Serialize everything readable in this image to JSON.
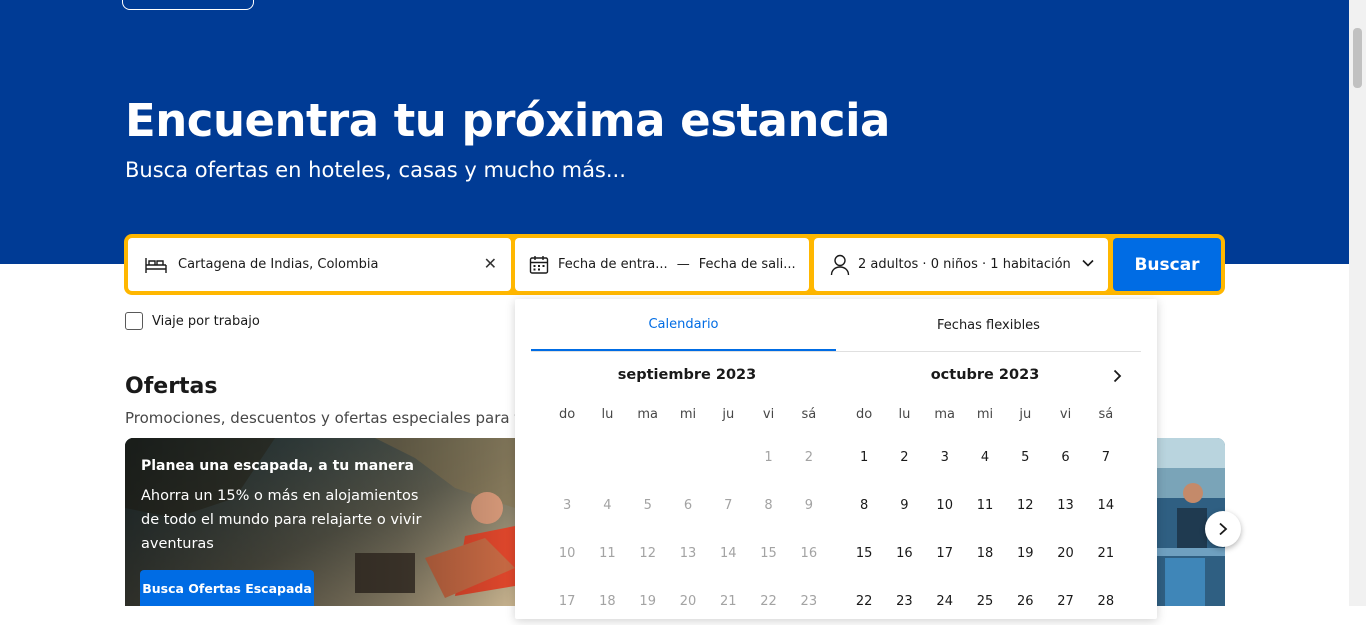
{
  "hero": {
    "title": "Encuentra tu próxima estancia",
    "subtitle": "Busca ofertas en hoteles, casas y mucho más..."
  },
  "search": {
    "destination": "Cartagena de Indias, Colombia",
    "checkin": "Fecha de entra...",
    "separator": "—",
    "checkout": "Fecha de sali...",
    "guests": "2 adultos · 0 niños · 1 habitación",
    "button": "Buscar"
  },
  "work_trip": {
    "label": "Viaje por trabajo",
    "checked": false
  },
  "offers": {
    "title": "Ofertas",
    "subtitle": "Promociones, descuentos y ofertas especiales para ti",
    "card": {
      "title": "Planea una escapada, a tu manera",
      "text": "Ahorra un 15% o más en alojamientos de todo el mundo para relajarte o vivir aventuras",
      "button": "Busca Ofertas Escapada"
    }
  },
  "calendar": {
    "tabs": [
      "Calendario",
      "Fechas flexibles"
    ],
    "active_tab": "Calendario",
    "weekdays": [
      "do",
      "lu",
      "ma",
      "mi",
      "ju",
      "vi",
      "sá"
    ],
    "months": [
      {
        "title": "septiembre 2023",
        "weeks": [
          [
            "",
            "",
            "",
            "",
            "",
            "1",
            "2"
          ],
          [
            "3",
            "4",
            "5",
            "6",
            "7",
            "8",
            "9"
          ],
          [
            "10",
            "11",
            "12",
            "13",
            "14",
            "15",
            "16"
          ],
          [
            "17",
            "18",
            "19",
            "20",
            "21",
            "22",
            "23"
          ]
        ],
        "state": "past"
      },
      {
        "title": "octubre 2023",
        "weeks": [
          [
            "1",
            "2",
            "3",
            "4",
            "5",
            "6",
            "7"
          ],
          [
            "8",
            "9",
            "10",
            "11",
            "12",
            "13",
            "14"
          ],
          [
            "15",
            "16",
            "17",
            "18",
            "19",
            "20",
            "21"
          ],
          [
            "22",
            "23",
            "24",
            "25",
            "26",
            "27",
            "28"
          ]
        ],
        "state": "future"
      }
    ]
  },
  "colors": {
    "hero_bg": "#003b95",
    "search_border": "#ffb700",
    "primary_button": "#006ce4",
    "past_day": "#a3a3a3"
  }
}
